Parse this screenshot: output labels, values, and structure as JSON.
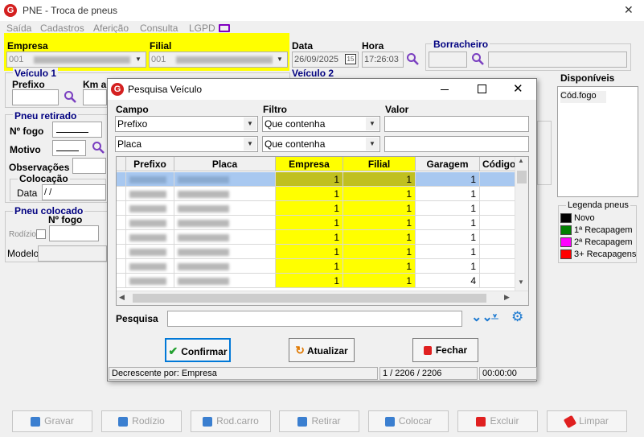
{
  "window": {
    "title": "PNE - Troca de pneus",
    "close": "✕"
  },
  "menu": [
    "Saída",
    "Cadastros",
    "Aferição",
    "Consulta",
    "LGPD"
  ],
  "form": {
    "empresa_label": "Empresa",
    "empresa_value": "001",
    "filial_label": "Filial",
    "filial_value": "001",
    "data_label": "Data",
    "data_value": "26/09/2025",
    "calendar_icon": "15",
    "hora_label": "Hora",
    "hora_value": "17:26:03",
    "borracheiro_label": "Borracheiro",
    "veiculo1_label": "Veículo 1",
    "veiculo2_label": "Veículo 2",
    "prefixo_label": "Prefixo",
    "km_label": "Km a",
    "pneu_retirado_label": "Pneu retirado",
    "nfogo_label": "Nº fogo",
    "motivo_label": "Motivo",
    "observacoes_label": "Observações",
    "colocacao_label": "Colocação",
    "colocacao_data_label": "Data",
    "colocacao_data_value": " /  /",
    "pneu_colocado_label": "Pneu colocado",
    "nfogo2_label": "Nº fogo",
    "rodizio_label": "Rodízio",
    "modelo_label": "Modelo",
    "disponiveis_label": "Disponíveis",
    "cod_fogo_label": "Cód.fogo"
  },
  "legend": {
    "title": "Legenda pneus",
    "items": [
      {
        "label": "Novo",
        "color": "#000000"
      },
      {
        "label": "1ª Recapagem",
        "color": "#008000"
      },
      {
        "label": "2ª Recapagem",
        "color": "#ff00ff"
      },
      {
        "label": "3+ Recapagens",
        "color": "#ff0000"
      }
    ]
  },
  "bottom_buttons": [
    {
      "label": "Gravar"
    },
    {
      "label": "Rodízio"
    },
    {
      "label": "Rod.carro"
    },
    {
      "label": "Retirar"
    },
    {
      "label": "Colocar"
    },
    {
      "label": "Excluir"
    },
    {
      "label": "Limpar"
    }
  ],
  "dialog": {
    "title": "Pesquisa Veículo",
    "campo_label": "Campo",
    "filtro_label": "Filtro",
    "valor_label": "Valor",
    "campo1": "Prefixo",
    "filtro1": "Que contenha",
    "campo2": "Placa",
    "filtro2": "Que contenha",
    "columns": [
      "Prefixo",
      "Placa",
      "Empresa",
      "Filial",
      "Garagem",
      "Código ir"
    ],
    "rows": [
      {
        "empresa": "1",
        "filial": "1",
        "garagem": "1"
      },
      {
        "empresa": "1",
        "filial": "1",
        "garagem": "1"
      },
      {
        "empresa": "1",
        "filial": "1",
        "garagem": "1"
      },
      {
        "empresa": "1",
        "filial": "1",
        "garagem": "1"
      },
      {
        "empresa": "1",
        "filial": "1",
        "garagem": "1"
      },
      {
        "empresa": "1",
        "filial": "1",
        "garagem": "1"
      },
      {
        "empresa": "1",
        "filial": "1",
        "garagem": "1"
      },
      {
        "empresa": "1",
        "filial": "1",
        "garagem": "4"
      }
    ],
    "pesquisa_label": "Pesquisa",
    "confirmar": "Confirmar",
    "atualizar": "Atualizar",
    "fechar": "Fechar",
    "status_sort": "Decrescente por: Empresa",
    "status_count": "1 / 2206 / 2206",
    "status_time": "00:00:00"
  }
}
